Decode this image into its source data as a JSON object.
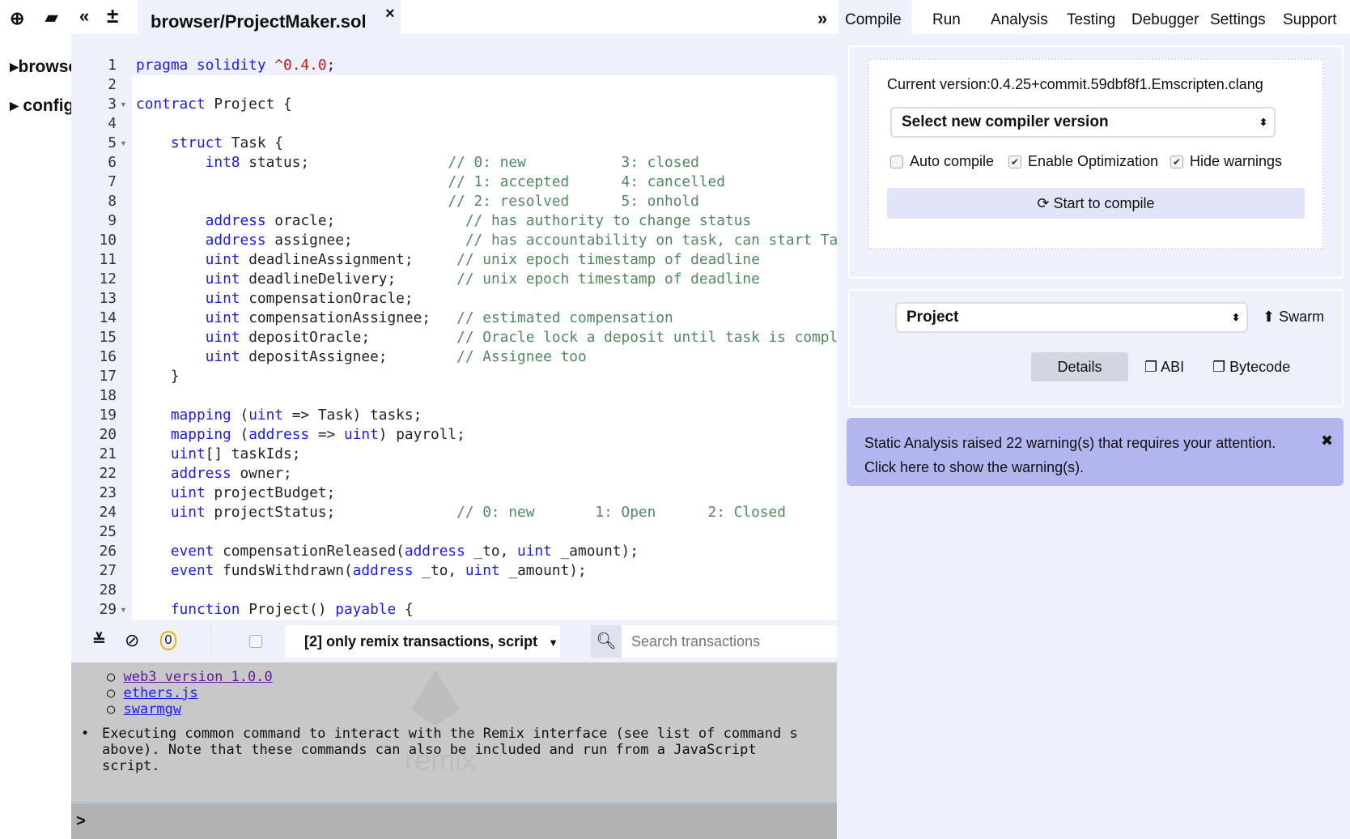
{
  "toolbar": {
    "icons": [
      "plus-circle-icon",
      "folder-open-icon",
      "double-chevron-left-icon",
      "plus-minus-icon"
    ]
  },
  "file_tab": {
    "label": "browser/ProjectMaker.sol",
    "close": "×"
  },
  "file_explorer": {
    "items": [
      {
        "label": "browser"
      },
      {
        "label": "config"
      }
    ]
  },
  "editor": {
    "lines": [
      [
        {
          "t": "pragma solidity ",
          "c": "k"
        },
        {
          "t": "^0.4.0",
          "c": "n"
        },
        {
          "t": ";"
        }
      ],
      [],
      [
        {
          "t": "contract ",
          "c": "k"
        },
        {
          "t": "Project {"
        }
      ],
      [],
      [
        {
          "t": "    "
        },
        {
          "t": "struct ",
          "c": "k"
        },
        {
          "t": "Task {"
        }
      ],
      [
        {
          "t": "        "
        },
        {
          "t": "int8",
          "c": "k"
        },
        {
          "t": " status;                "
        },
        {
          "t": "// 0: new           3: closed",
          "c": "c"
        }
      ],
      [
        {
          "t": "                                    "
        },
        {
          "t": "// 1: accepted      4: cancelled",
          "c": "c"
        }
      ],
      [
        {
          "t": "                                    "
        },
        {
          "t": "// 2: resolved      5: onhold",
          "c": "c"
        }
      ],
      [
        {
          "t": "        "
        },
        {
          "t": "address",
          "c": "k"
        },
        {
          "t": " oracle;               "
        },
        {
          "t": "// has authority to change status",
          "c": "c"
        }
      ],
      [
        {
          "t": "        "
        },
        {
          "t": "address",
          "c": "k"
        },
        {
          "t": " assignee;             "
        },
        {
          "t": "// has accountability on task, can start Task",
          "c": "c"
        }
      ],
      [
        {
          "t": "        "
        },
        {
          "t": "uint",
          "c": "k"
        },
        {
          "t": " deadlineAssignment;     "
        },
        {
          "t": "// unix epoch timestamp of deadline",
          "c": "c"
        }
      ],
      [
        {
          "t": "        "
        },
        {
          "t": "uint",
          "c": "k"
        },
        {
          "t": " deadlineDelivery;       "
        },
        {
          "t": "// unix epoch timestamp of deadline",
          "c": "c"
        }
      ],
      [
        {
          "t": "        "
        },
        {
          "t": "uint",
          "c": "k"
        },
        {
          "t": " compensationOracle;"
        }
      ],
      [
        {
          "t": "        "
        },
        {
          "t": "uint",
          "c": "k"
        },
        {
          "t": " compensationAssignee;   "
        },
        {
          "t": "// estimated compensation",
          "c": "c"
        }
      ],
      [
        {
          "t": "        "
        },
        {
          "t": "uint",
          "c": "k"
        },
        {
          "t": " depositOracle;          "
        },
        {
          "t": "// Oracle lock a deposit until task is completed",
          "c": "c"
        }
      ],
      [
        {
          "t": "        "
        },
        {
          "t": "uint",
          "c": "k"
        },
        {
          "t": " depositAssignee;        "
        },
        {
          "t": "// Assignee too",
          "c": "c"
        }
      ],
      [
        {
          "t": "    }"
        }
      ],
      [],
      [
        {
          "t": "    "
        },
        {
          "t": "mapping",
          "c": "k"
        },
        {
          "t": " ("
        },
        {
          "t": "uint",
          "c": "k"
        },
        {
          "t": " => Task) tasks;"
        }
      ],
      [
        {
          "t": "    "
        },
        {
          "t": "mapping",
          "c": "k"
        },
        {
          "t": " ("
        },
        {
          "t": "address",
          "c": "k"
        },
        {
          "t": " => "
        },
        {
          "t": "uint",
          "c": "k"
        },
        {
          "t": ") payroll;"
        }
      ],
      [
        {
          "t": "    "
        },
        {
          "t": "uint",
          "c": "k"
        },
        {
          "t": "[] taskIds;"
        }
      ],
      [
        {
          "t": "    "
        },
        {
          "t": "address",
          "c": "k"
        },
        {
          "t": " owner;"
        }
      ],
      [
        {
          "t": "    "
        },
        {
          "t": "uint",
          "c": "k"
        },
        {
          "t": " projectBudget;"
        }
      ],
      [
        {
          "t": "    "
        },
        {
          "t": "uint",
          "c": "k"
        },
        {
          "t": " projectStatus;              "
        },
        {
          "t": "// 0: new       1: Open      2: Closed",
          "c": "c"
        }
      ],
      [],
      [
        {
          "t": "    "
        },
        {
          "t": "event",
          "c": "k"
        },
        {
          "t": " compensationReleased("
        },
        {
          "t": "address",
          "c": "k"
        },
        {
          "t": " _to, "
        },
        {
          "t": "uint",
          "c": "k"
        },
        {
          "t": " _amount);"
        }
      ],
      [
        {
          "t": "    "
        },
        {
          "t": "event",
          "c": "k"
        },
        {
          "t": " fundsWithdrawn("
        },
        {
          "t": "address",
          "c": "k"
        },
        {
          "t": " _to, "
        },
        {
          "t": "uint",
          "c": "k"
        },
        {
          "t": " _amount);"
        }
      ],
      [],
      [
        {
          "t": "    "
        },
        {
          "t": "function",
          "c": "k"
        },
        {
          "t": " Project() "
        },
        {
          "t": "payable",
          "c": "k"
        },
        {
          "t": " {"
        }
      ]
    ],
    "fold_lines": [
      3,
      5,
      29
    ]
  },
  "terminal": {
    "pending_count": "0",
    "filter": "[2] only remix transactions, script",
    "search_placeholder": "Search transactions",
    "links": [
      "web3 version 1.0.0",
      "ethers.js",
      "swarmgw"
    ],
    "message": "Executing common command to interact with the Remix interface (see list of command s above). Note that these commands can also be included and run from a JavaScript script.",
    "watermark": "remix",
    "prompt": ">"
  },
  "right_panel": {
    "tabs": [
      "Compile",
      "Run",
      "Analysis",
      "Testing",
      "Debugger",
      "Settings",
      "Support"
    ],
    "active_tab": "Compile",
    "current_version": "Current version:0.4.25+commit.59dbf8f1.Emscripten.clang",
    "compiler_select": "Select new compiler version",
    "options": [
      {
        "label": "Auto compile",
        "checked": false
      },
      {
        "label": "Enable Optimization",
        "checked": true
      },
      {
        "label": "Hide warnings",
        "checked": true
      }
    ],
    "compile_button": "Start to compile",
    "contract_select": "Project",
    "swarm": "Swarm",
    "details": "Details",
    "abi": "ABI",
    "bytecode": "Bytecode",
    "warning": "Static Analysis raised 22 warning(s) that requires your attention. Click here to show the warning(s).",
    "warning_close": "✖"
  },
  "colors": {
    "panel": "#eef0fc",
    "keyword": "#1a1aff",
    "number": "#c41a16",
    "comment": "#4f8a5f",
    "warning_bg": "#b3b6ee",
    "console": "#c8c8c8"
  }
}
